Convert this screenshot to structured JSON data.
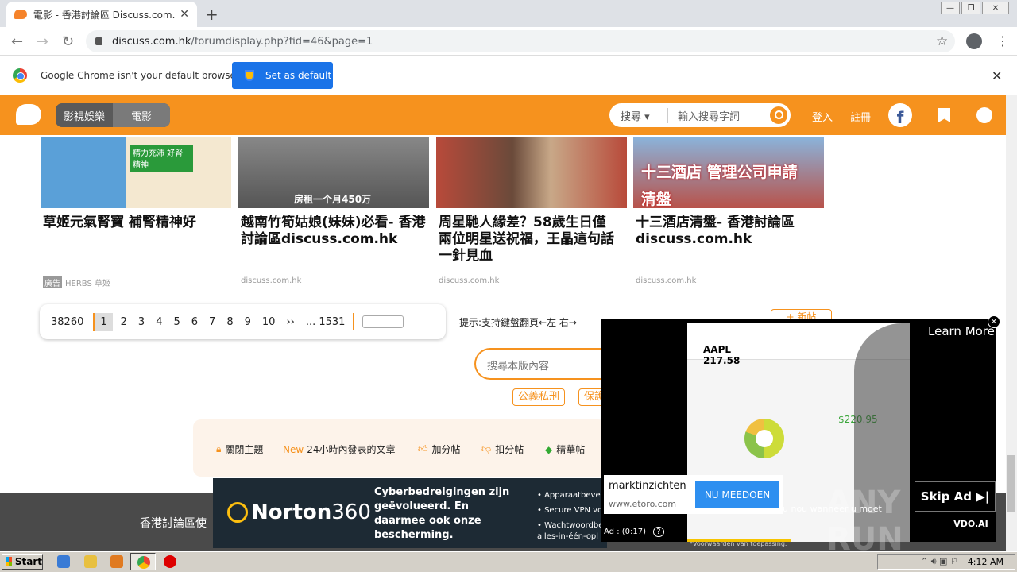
{
  "browser": {
    "tab_title": "電影 - 香港討論區 Discuss.com.hk -",
    "tab_close": "✕",
    "new_tab": "+",
    "url_host": "discuss.com.hk",
    "url_path": "/forumdisplay.php?fid=46&page=1",
    "infobar_text": "Google Chrome isn't your default browser",
    "set_default_label": "Set as default",
    "infobar_close": "✕"
  },
  "site_header": {
    "nav": [
      "影視娛樂",
      "電影"
    ],
    "search_scope": "搜尋",
    "search_placeholder": "輸入搜尋字詞",
    "login": "登入",
    "register": "註冊",
    "fb_letter": "f"
  },
  "cards": [
    {
      "title": "草姬元氣腎寶 補腎精神好",
      "source": "HERBS 草姬",
      "ad_badge": "廣告",
      "img_text": "精力充沛 好腎精神"
    },
    {
      "title": "越南竹筍姑娘(妹妹)必看- 香港討論區discuss.com.hk",
      "source": "discuss.com.hk",
      "img_text": "房租一个月450万"
    },
    {
      "title": "周星馳人緣差？58歲生日僅兩位明星送祝福，王晶這句話一針見血",
      "source": "discuss.com.hk",
      "img_text": ""
    },
    {
      "title": "十三酒店清盤- 香港討論區discuss.com.hk",
      "source": "discuss.com.hk",
      "img_text": "十三酒店 管理公司申請清盤"
    }
  ],
  "pager": {
    "total": "38260",
    "current": "1",
    "pages": [
      "2",
      "3",
      "4",
      "5",
      "6",
      "7",
      "8",
      "9",
      "10"
    ],
    "next": "››",
    "last": "... 1531"
  },
  "hint": "提示:支持鍵盤翻頁←左 右→",
  "new_post": "+ 新帖",
  "board_search_placeholder": "搜尋本版內容",
  "tags": [
    "公義私刑",
    "保護"
  ],
  "legend": [
    "關閉主題",
    "New",
    "24小時內發表的文章",
    "加分帖",
    "扣分帖",
    "精華帖"
  ],
  "footer_text": "香港討論區使",
  "norton_ad": {
    "brand": "Norton",
    "brand_num": "360",
    "headline": "Cyberbedreigingen zijn geëvolueerd. En daarmee ook onze bescherming.",
    "bullets": [
      "• Apparaatbeveili",
      "• Secure VPN voo",
      "• Wachtwoordbel",
      "  alles-in-één-opl"
    ],
    "fine_print": "*Voorwaarden van toepassing."
  },
  "video_ad": {
    "learn_more": "Learn More",
    "ticker": "AAPL",
    "price": "217.58",
    "value": "$220.95",
    "advertiser": "marktinzichten",
    "advertiser_url": "www.etoro.com",
    "cta": "NU MEEDOEN",
    "timer": "Ad : (0:17)",
    "skip": "Skip Ad ▶|",
    "vdo_logo": "VDO.AI",
    "close": "✕",
    "watermark": "ANY RUN",
    "subtitle": "u nou wanneer u moet"
  },
  "taskbar": {
    "start": "Start",
    "time": "4:12 AM"
  }
}
